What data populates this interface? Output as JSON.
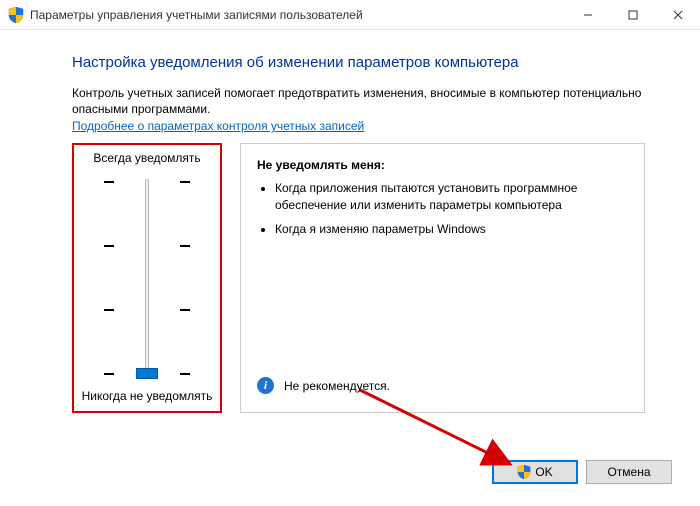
{
  "window": {
    "title": "Параметры управления учетными записями пользователей"
  },
  "heading": "Настройка уведомления об изменении параметров компьютера",
  "description": "Контроль учетных записей помогает предотвратить изменения, вносимые в компьютер потенциально опасными программами.",
  "link": "Подробнее о параметрах контроля учетных записей",
  "slider": {
    "top_label": "Всегда уведомлять",
    "bottom_label": "Никогда не уведомлять",
    "levels": 4,
    "value_index": 3
  },
  "info": {
    "title": "Не уведомлять меня:",
    "bullets": [
      "Когда приложения пытаются установить программное обеспечение или изменить параметры компьютера",
      "Когда я изменяю параметры Windows"
    ],
    "recommend": "Не рекомендуется."
  },
  "buttons": {
    "ok": "OK",
    "cancel": "Отмена"
  }
}
